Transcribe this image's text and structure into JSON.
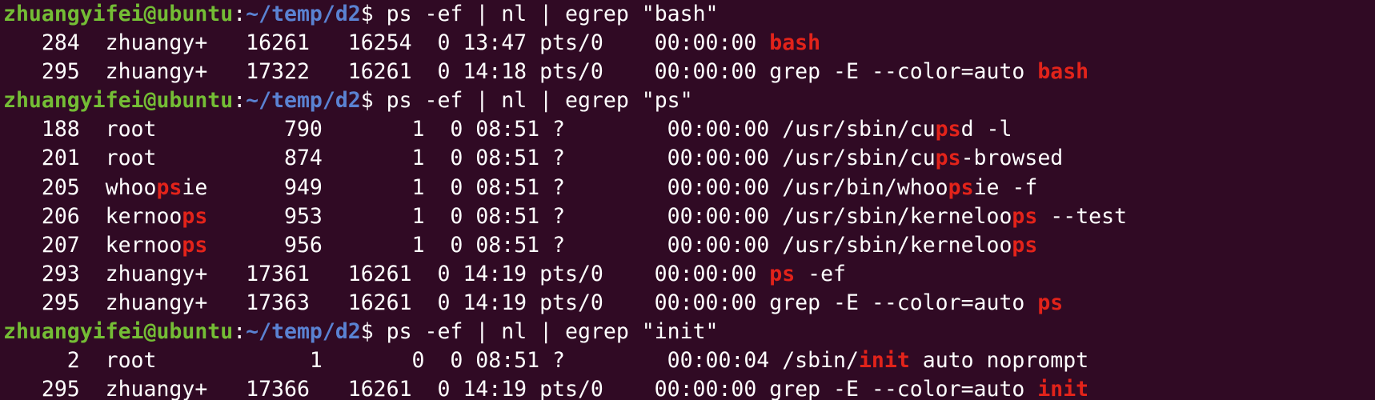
{
  "lines": [
    {
      "type": "prompt",
      "user": "zhuangyifei@ubuntu",
      "sep": ":",
      "path": "~/temp/d2",
      "command": "$ ps -ef | nl | egrep \"bash\""
    },
    {
      "type": "out",
      "segments": [
        {
          "t": "   284  zhuangy+   16261   16254  0 13:47 pts/0    00:00:00 ",
          "m": false
        },
        {
          "t": "bash",
          "m": true
        }
      ]
    },
    {
      "type": "out",
      "segments": [
        {
          "t": "   295  zhuangy+   17322   16261  0 14:18 pts/0    00:00:00 grep -E --color=auto ",
          "m": false
        },
        {
          "t": "bash",
          "m": true
        }
      ]
    },
    {
      "type": "prompt",
      "user": "zhuangyifei@ubuntu",
      "sep": ":",
      "path": "~/temp/d2",
      "command": "$ ps -ef | nl | egrep \"ps\""
    },
    {
      "type": "out",
      "segments": [
        {
          "t": "   188  root          790       1  0 08:51 ?        00:00:00 /usr/sbin/cu",
          "m": false
        },
        {
          "t": "ps",
          "m": true
        },
        {
          "t": "d -l",
          "m": false
        }
      ]
    },
    {
      "type": "out",
      "segments": [
        {
          "t": "   201  root          874       1  0 08:51 ?        00:00:00 /usr/sbin/cu",
          "m": false
        },
        {
          "t": "ps",
          "m": true
        },
        {
          "t": "-browsed",
          "m": false
        }
      ]
    },
    {
      "type": "out",
      "segments": [
        {
          "t": "   205  whoo",
          "m": false
        },
        {
          "t": "ps",
          "m": true
        },
        {
          "t": "ie      949       1  0 08:51 ?        00:00:00 /usr/bin/whoo",
          "m": false
        },
        {
          "t": "ps",
          "m": true
        },
        {
          "t": "ie -f",
          "m": false
        }
      ]
    },
    {
      "type": "out",
      "segments": [
        {
          "t": "   206  kernoo",
          "m": false
        },
        {
          "t": "ps",
          "m": true
        },
        {
          "t": "      953       1  0 08:51 ?        00:00:00 /usr/sbin/kerneloo",
          "m": false
        },
        {
          "t": "ps",
          "m": true
        },
        {
          "t": " --test",
          "m": false
        }
      ]
    },
    {
      "type": "out",
      "segments": [
        {
          "t": "   207  kernoo",
          "m": false
        },
        {
          "t": "ps",
          "m": true
        },
        {
          "t": "      956       1  0 08:51 ?        00:00:00 /usr/sbin/kerneloo",
          "m": false
        },
        {
          "t": "ps",
          "m": true
        }
      ]
    },
    {
      "type": "out",
      "segments": [
        {
          "t": "   293  zhuangy+   17361   16261  0 14:19 pts/0    00:00:00 ",
          "m": false
        },
        {
          "t": "ps",
          "m": true
        },
        {
          "t": " -ef",
          "m": false
        }
      ]
    },
    {
      "type": "out",
      "segments": [
        {
          "t": "   295  zhuangy+   17363   16261  0 14:19 pts/0    00:00:00 grep -E --color=auto ",
          "m": false
        },
        {
          "t": "ps",
          "m": true
        }
      ]
    },
    {
      "type": "prompt",
      "user": "zhuangyifei@ubuntu",
      "sep": ":",
      "path": "~/temp/d2",
      "command": "$ ps -ef | nl | egrep \"init\""
    },
    {
      "type": "out",
      "segments": [
        {
          "t": "     2  root            1       0  0 08:51 ?        00:00:04 /sbin/",
          "m": false
        },
        {
          "t": "init",
          "m": true
        },
        {
          "t": " auto noprompt",
          "m": false
        }
      ]
    },
    {
      "type": "out",
      "segments": [
        {
          "t": "   295  zhuangy+   17366   16261  0 14:19 pts/0    00:00:00 grep -E --color=auto ",
          "m": false
        },
        {
          "t": "init",
          "m": true
        }
      ]
    }
  ]
}
